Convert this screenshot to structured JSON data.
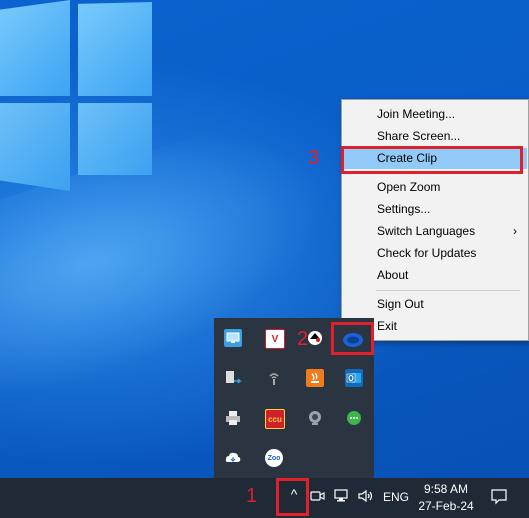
{
  "context_menu": {
    "items": [
      {
        "label": "Join Meeting..."
      },
      {
        "label": "Share Screen..."
      },
      {
        "label": "Create Clip"
      },
      {
        "label": "Open Zoom"
      },
      {
        "label": "Settings..."
      },
      {
        "label": "Switch Languages",
        "arrow": "›"
      },
      {
        "label": "Check for Updates"
      },
      {
        "label": "About"
      },
      {
        "label": "Sign Out"
      },
      {
        "label": "Exit"
      }
    ]
  },
  "tray_icons": {
    "v_label": "V",
    "cc_label": "ccu",
    "zoom_label": "Zoo"
  },
  "taskbar": {
    "show_hidden_icon": "^",
    "language": "ENG",
    "time": "9:58 AM",
    "date": "27-Feb-24"
  },
  "annotations": {
    "step1": "1",
    "step2": "2",
    "step3": "3"
  },
  "colors": {
    "highlight": "#91c9f7",
    "annotation_red": "#e0202a",
    "taskbar": "#1f2a36",
    "flyout": "#2b3441"
  }
}
